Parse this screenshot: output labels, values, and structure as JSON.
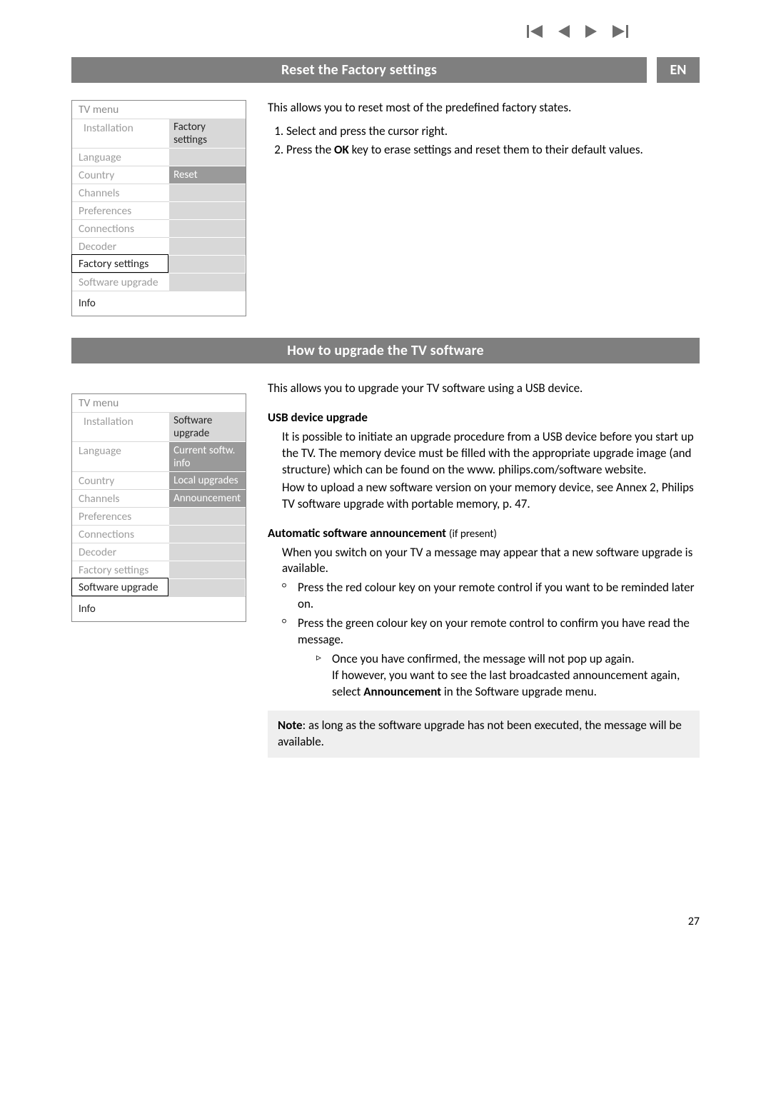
{
  "lang_badge": "EN",
  "section1": {
    "title": "Reset the Factory settings",
    "intro": "This allows you to reset most of the predefined factory states.",
    "steps": [
      "Select and press the cursor right.",
      "Press the OK key to erase settings and reset them to their default values."
    ],
    "menu": {
      "title": "TV menu",
      "sublabel": "Installation",
      "right_header": "Factory settings",
      "items": [
        "Language",
        "Country",
        "Channels",
        "Preferences",
        "Connections",
        "Decoder",
        "Factory settings",
        "Software upgrade"
      ],
      "active": "Factory settings",
      "right_items": [
        "Reset"
      ],
      "highlight_right": "Reset",
      "info": "Info"
    }
  },
  "section2": {
    "title": "How to upgrade the TV software",
    "intro": "This allows you to upgrade your TV software using a USB device.",
    "usb_heading": "USB device upgrade",
    "usb_p1": "It is possible to initiate an upgrade procedure from a USB device before you start up the TV. The memory device must be filled with the appropriate upgrade image (and structure) which can be found on the www. philips.com/software website.",
    "usb_p2": "How to upload a new software version on your memory device, see Annex 2, Philips TV software upgrade with portable memory, p. 47.",
    "auto_heading": "Automatic software announcement",
    "auto_heading_note": "(if present)",
    "auto_p1": "When you switch on your TV a message may appear that a new software upgrade is available.",
    "auto_b1": "Press the red colour key on your remote control if you want to be reminded later on.",
    "auto_b2": "Press the green colour key on your remote control to confirm you have read the message.",
    "auto_sub1": "Once you have confirmed, the message will not pop up again.",
    "auto_sub2a": "If however, you want to see the last broadcasted announcement again, select ",
    "auto_sub2b": "Announcement",
    "auto_sub2c": " in the Software upgrade menu.",
    "note_label": "Note",
    "note_text": ": as long as the software upgrade has not been executed, the message will be available.",
    "menu": {
      "title": "TV menu",
      "sublabel": "Installation",
      "right_header": "Software upgrade",
      "items": [
        "Language",
        "Country",
        "Channels",
        "Preferences",
        "Connections",
        "Decoder",
        "Factory settings",
        "Software upgrade"
      ],
      "active": "Software upgrade",
      "right_items": [
        "Current softw. info",
        "Local upgrades",
        "Announcement"
      ],
      "info": "Info"
    }
  },
  "page_number": "27"
}
